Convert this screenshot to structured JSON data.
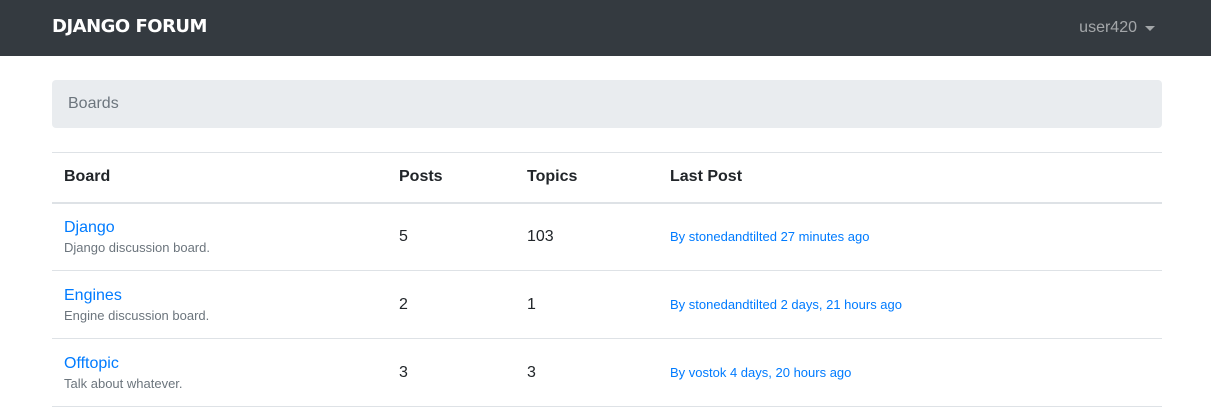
{
  "navbar": {
    "brand": "DJANGO FORUM",
    "user": "user420"
  },
  "breadcrumb": {
    "current": "Boards"
  },
  "table": {
    "headers": {
      "board": "Board",
      "posts": "Posts",
      "topics": "Topics",
      "last_post": "Last Post"
    },
    "rows": [
      {
        "name": "Django",
        "description": "Django discussion board.",
        "posts": "5",
        "topics": "103",
        "last_post": "By stonedandtilted 27 minutes ago"
      },
      {
        "name": "Engines",
        "description": "Engine discussion board.",
        "posts": "2",
        "topics": "1",
        "last_post": "By stonedandtilted 2 days, 21 hours ago"
      },
      {
        "name": "Offtopic",
        "description": "Talk about whatever.",
        "posts": "3",
        "topics": "3",
        "last_post": "By vostok 4 days, 20 hours ago"
      }
    ]
  },
  "colors": {
    "navbar_bg": "#343a40",
    "link": "#007bff",
    "muted": "#6c757d",
    "breadcrumb_bg": "#e9ecef"
  }
}
